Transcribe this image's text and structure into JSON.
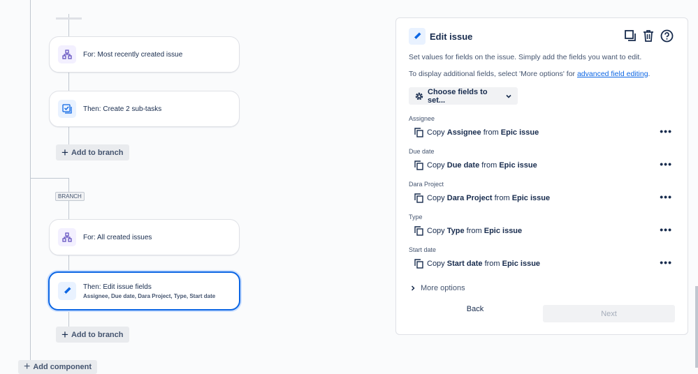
{
  "canvas": {
    "nodes": [
      {
        "label": "For: Most recently created issue",
        "icon": "branch-icon"
      },
      {
        "label": "Then: Create 2 sub-tasks",
        "icon": "subtasks-icon"
      },
      {
        "label": "For: All created issues",
        "icon": "branch-icon"
      },
      {
        "label": "Then: Edit issue fields",
        "sublabel": "Assignee, Due date, Dara Project, Type, Start date",
        "icon": "pencil-icon"
      }
    ],
    "add_to_branch_label": "Add to branch",
    "branch_label": "BRANCH",
    "add_component_label": "Add component"
  },
  "panel": {
    "title": "Edit issue",
    "desc1": "Set values for fields on the issue. Simply add the fields you want to edit.",
    "desc2_prefix": "To display additional fields, select 'More options' for ",
    "desc2_link": "advanced field editing",
    "desc2_suffix": ".",
    "choose_label": "Choose fields to set...",
    "fields": [
      {
        "label": "Assignee",
        "copy": "Copy",
        "name": "Assignee",
        "from": "from",
        "source": "Epic issue"
      },
      {
        "label": "Due date",
        "copy": "Copy",
        "name": "Due date",
        "from": "from",
        "source": "Epic issue"
      },
      {
        "label": "Dara Project",
        "copy": "Copy",
        "name": "Dara Project",
        "from": "from",
        "source": "Epic issue"
      },
      {
        "label": "Type",
        "copy": "Copy",
        "name": "Type",
        "from": "from",
        "source": "Epic issue"
      },
      {
        "label": "Start date",
        "copy": "Copy",
        "name": "Start date",
        "from": "from",
        "source": "Epic issue"
      }
    ],
    "more_options": "More options",
    "back": "Back",
    "next": "Next"
  },
  "colors": {
    "accent": "#0c66e4",
    "purple_icon": "#6554c0"
  }
}
